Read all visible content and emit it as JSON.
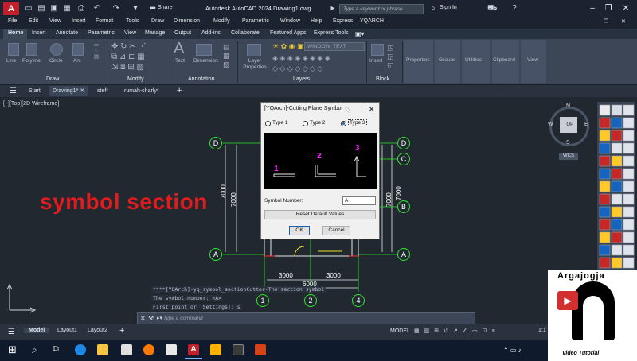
{
  "titlebar": {
    "app_icon": "A",
    "share": "Share",
    "window_title": "Autodesk AutoCAD 2024   Drawing1.dwg",
    "search_placeholder": "Type a keyword or phrase",
    "sign_in": "Sign In"
  },
  "menu": [
    "File",
    "Edit",
    "View",
    "Insert",
    "Format",
    "Tools",
    "Draw",
    "Dimension",
    "Modify",
    "Parametric",
    "Window",
    "Help",
    "Express",
    "YQARCH"
  ],
  "ribbon_tabs": [
    "Home",
    "Insert",
    "Annotate",
    "Parametric",
    "View",
    "Manage",
    "Output",
    "Add-ins",
    "Collaborate",
    "Featured Apps",
    "Express Tools"
  ],
  "ribbon": {
    "draw_tools": [
      "Line",
      "Polyline",
      "Circle",
      "Arc"
    ],
    "panel_draw": "Draw",
    "panel_modify": "Modify",
    "panel_annotation": "Annotation",
    "panel_layers": "Layers",
    "panel_block": "Block",
    "text_btn": "Text",
    "dimension_btn": "Dimension",
    "layer_props": "Layer\nProperties",
    "layer_name": "WINDOW_TEXT",
    "insert_btn": "Insert",
    "properties_btn": "Properties",
    "groups_btn": "Groups",
    "utilities_btn": "Utilities",
    "clipboard_btn": "Clipboard",
    "view_btn": "View"
  },
  "file_tabs": [
    "Start",
    "Drawing1*",
    "stef*",
    "rumah-charly*"
  ],
  "viewport_label": "[−][Top][2D Wireframe]",
  "viewcube": {
    "top": "TOP",
    "n": "N",
    "s": "S",
    "e": "E",
    "w": "W",
    "wcs": "WCS"
  },
  "overlay_title": "symbol section",
  "drawing": {
    "dim_left": "7000",
    "dim_left2": "7000",
    "dim_right": "7000",
    "dim_right2": "7000",
    "dim_bottom_1": "3000",
    "dim_bottom_2": "3000",
    "dim_total": "6000",
    "grid_left": [
      "D",
      "A"
    ],
    "grid_right": [
      "D",
      "C",
      "B",
      "A"
    ],
    "grid_bottom": [
      "1",
      "2",
      "4"
    ]
  },
  "dialog": {
    "title": "[YQArch]-Cutting Plane Symbol",
    "type1": "Type 1",
    "type2": "Type 2",
    "type3": "Type 3",
    "selected": "Type 3",
    "preview_labels": [
      "1",
      "2",
      "3"
    ],
    "symbol_number_label": "Symbol Number:",
    "symbol_number_value": "A",
    "reset_button": "Reset Default Values",
    "ok_button": "OK",
    "cancel_button": "Cancel"
  },
  "command": {
    "history": [
      "****[YQArch]-yq_symbol_sectionCutter-The section symbol",
      "The symbol number: <A>",
      "First point or [Settings]: s"
    ],
    "placeholder": "Type a command"
  },
  "layout_tabs": [
    "Model",
    "Layout1",
    "Layout2"
  ],
  "status_model": "MODEL",
  "status_scale": "1:1",
  "watermark": {
    "name": "Argajogja",
    "tagline": "Video Tutorial",
    "letter": "A"
  },
  "colors": {
    "accent": "#c0202a",
    "overlay_text": "#e01c1c",
    "grid_green": "#2ee82e",
    "preview_magenta": "#ff22ff"
  }
}
